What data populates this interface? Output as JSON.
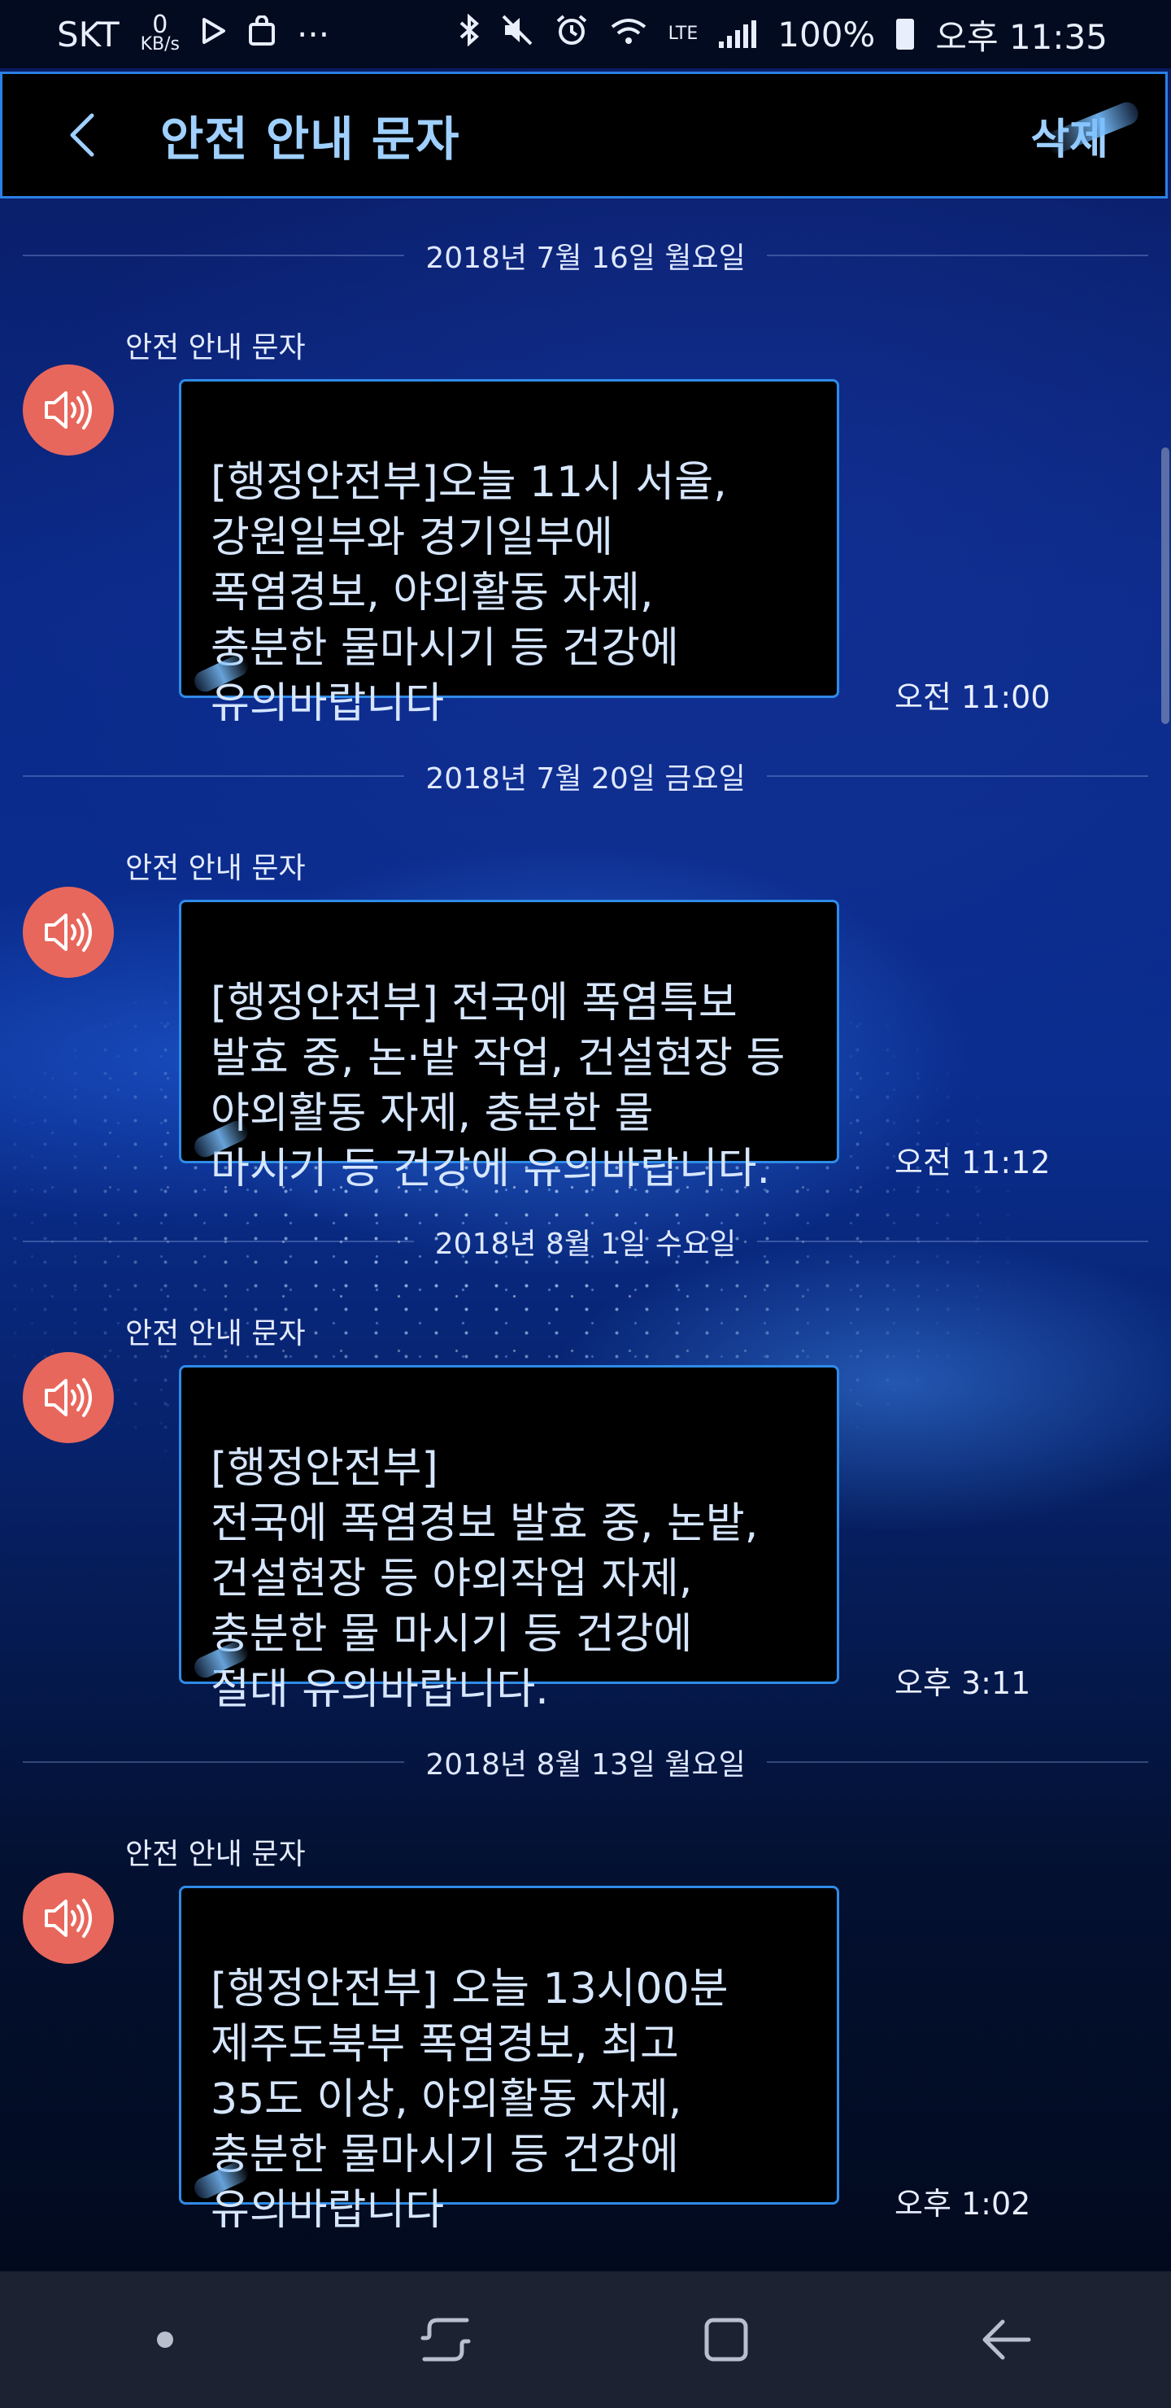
{
  "status_bar": {
    "carrier": "SKT",
    "data_speed_value": "0",
    "data_speed_unit": "KB/s",
    "more": "···",
    "network": "LTE",
    "battery_percent": "100%",
    "time": "오후 11:35"
  },
  "header": {
    "title": "안전 안내 문자",
    "delete_label": "삭제"
  },
  "messages": [
    {
      "date": "2018년 7월 16일 월요일",
      "sender": "안전 안내 문자",
      "text": "[행정안전부]오늘 11시 서울,\n강원일부와 경기일부에\n폭염경보, 야외활동 자제,\n충분한 물마시기 등 건강에\n유의바랍니다",
      "time": "오전 11:00"
    },
    {
      "date": "2018년 7월 20일 금요일",
      "sender": "안전 안내 문자",
      "text": "[행정안전부] 전국에 폭염특보\n발효 중, 논·밭 작업, 건설현장 등\n야외활동 자제, 충분한 물\n마시기 등 건강에 유의바랍니다.",
      "time": "오전 11:12"
    },
    {
      "date": "2018년 8월 1일 수요일",
      "sender": "안전 안내 문자",
      "text": "[행정안전부]\n전국에 폭염경보 발효 중, 논밭,\n건설현장 등 야외작업 자제,\n충분한 물 마시기 등 건강에\n절대 유의바랍니다.",
      "time": "오후 3:11"
    },
    {
      "date": "2018년 8월 13일 월요일",
      "sender": "안전 안내 문자",
      "text": "[행정안전부] 오늘 13시00분\n제주도북부 폭염경보, 최고\n35도 이상, 야외활동 자제,\n충분한 물마시기 등 건강에\n유의바랍니다",
      "time": "오후 1:02"
    }
  ],
  "icons": {
    "back": "chevron-left-icon",
    "speaker": "speaker-icon",
    "nav_recent": "recent-apps-icon",
    "nav_home": "home-icon",
    "nav_back": "back-arrow-icon"
  },
  "colors": {
    "accent_border": "#2f8be8",
    "title_color": "#9fd0ff",
    "speaker_bg": "#e8675c",
    "bubble_bg": "#000000"
  }
}
